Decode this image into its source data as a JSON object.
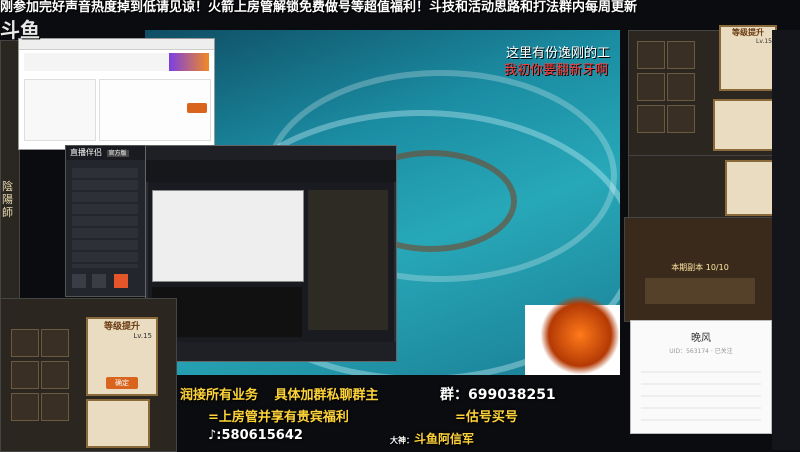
{
  "marquee_text": "刚参加完好声音热度掉到低请见谅！火箭上房管解锁免费做号等超值福利！斗技和活动思路和打法群内每周更新",
  "platform_logo": "斗鱼",
  "overlay_top_1": "这里有份逸刚的工",
  "overlay_top_2": "我初你要翻新牙啊",
  "banner": {
    "line1_prefix": "润接所有业务",
    "line1_mid": "具体加群私聊群主",
    "line1_group_label": "群：",
    "line1_group_num": "699038251",
    "line2": "=上房管并享有贵宾福利",
    "line2_right": "=估号买号",
    "line3_tiktok": "580615642",
    "line3_right_prefix": "大神：",
    "line3_right": "斗鱼阿信军"
  },
  "left_side_text": "陰陽師",
  "stream_app": {
    "title": "直播伴侣",
    "tag": "官方版"
  },
  "left_card": {
    "title": "等级提升",
    "level_label": "Lv.15",
    "button_label": "确定"
  },
  "right_card": {
    "title": "等级提升",
    "level_label": "Lv.15"
  },
  "right_mid_label": "本期副本 10/10",
  "chatbox": {
    "name": "晚风",
    "subtitle": "UID：563174 · 已关注"
  },
  "colors": {
    "accent_yellow": "#ffd43a",
    "accent_red": "#ff3b3b",
    "ocean": "#1b8da3"
  }
}
